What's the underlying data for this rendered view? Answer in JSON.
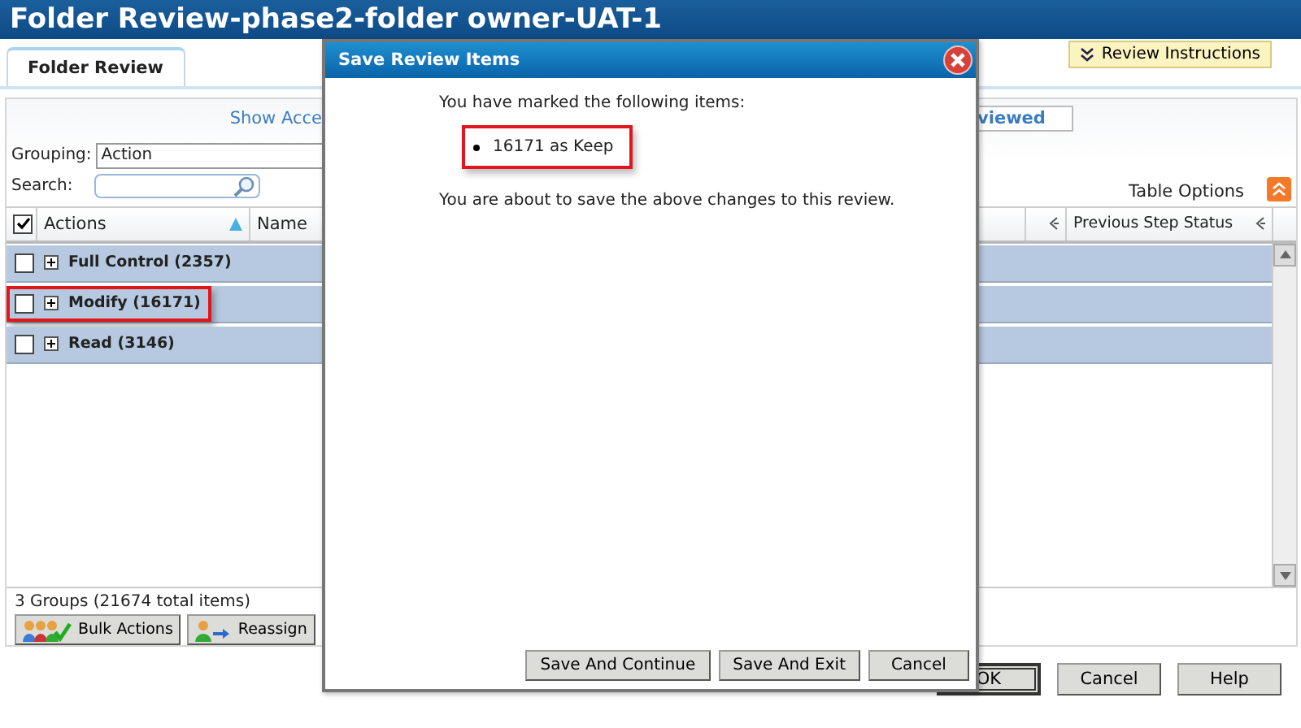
{
  "window": {
    "title": "Folder Review-phase2-folder owner-UAT-1"
  },
  "tabs": [
    {
      "label": "Folder Review",
      "selected": true
    }
  ],
  "review_instructions": {
    "label": "Review Instructions"
  },
  "panel": {
    "link": "Show Acce",
    "filter_button": "viewed",
    "grouping": {
      "label": "Grouping:",
      "value": "Action"
    },
    "search": {
      "label": "Search:"
    },
    "table_options": "Table Options"
  },
  "table": {
    "select_all_checked": true,
    "columns": [
      {
        "label": "Actions",
        "sorted": true
      },
      {
        "label": "Name",
        "sorted": false
      },
      {
        "label": "Previous Step Status",
        "sorted": false
      }
    ],
    "rows": [
      {
        "label": "Full Control (2357)",
        "checked": false,
        "highlighted": false
      },
      {
        "label": "Modify (16171)",
        "checked": false,
        "highlighted": true
      },
      {
        "label": "Read (3146)",
        "checked": false,
        "highlighted": false
      }
    ]
  },
  "status": "3 Groups (21674 total items)",
  "actions": [
    {
      "label": "Bulk Actions",
      "kind": "bulk"
    },
    {
      "label": "Reassign",
      "kind": "reassign"
    }
  ],
  "footer_buttons": [
    {
      "label": "OK",
      "default": true
    },
    {
      "label": "Cancel",
      "default": false
    },
    {
      "label": "Help",
      "default": false
    }
  ],
  "dialog": {
    "title": "Save Review Items",
    "intro": "You have marked the following items:",
    "items": [
      {
        "text": "16171 as Keep",
        "highlighted": true
      }
    ],
    "note": "You are about to save the above changes to this review.",
    "buttons": [
      "Save And Continue",
      "Save And Exit",
      "Cancel"
    ]
  }
}
